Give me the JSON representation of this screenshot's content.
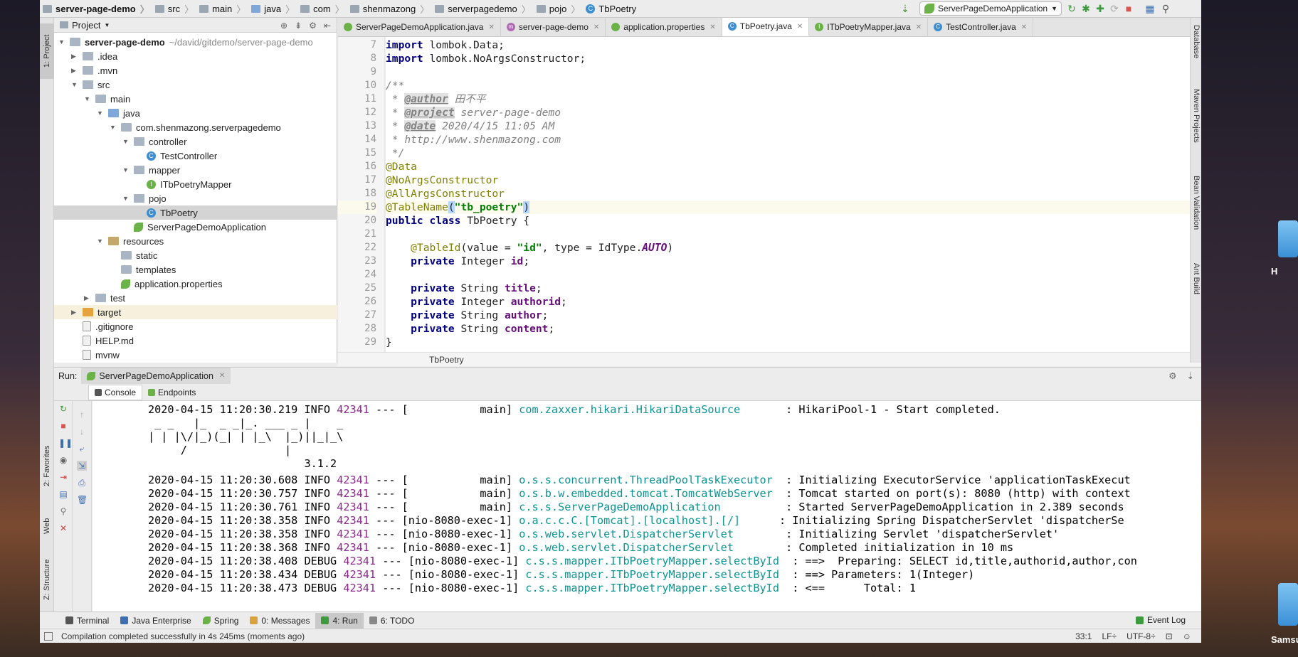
{
  "desktop": {
    "drive_label_top": "H",
    "drive_label_bottom": "Samsu"
  },
  "navbar": {
    "crumbs": [
      "server-page-demo",
      "src",
      "main",
      "java",
      "com",
      "shenmazong",
      "serverpagedemo",
      "pojo",
      "TbPoetry"
    ],
    "run_config": "ServerPageDemoApplication"
  },
  "left_stripe": {
    "project": "1: Project",
    "favorites": "2: Favorites",
    "web": "Web",
    "structure": "Z: Structure"
  },
  "project_panel": {
    "title": "Project",
    "tree": [
      {
        "label": "server-page-demo",
        "note": "~/david/gitdemo/server-page-demo"
      },
      {
        "label": ".idea"
      },
      {
        "label": ".mvn"
      },
      {
        "label": "src"
      },
      {
        "label": "main"
      },
      {
        "label": "java"
      },
      {
        "label": "com.shenmazong.serverpagedemo"
      },
      {
        "label": "controller"
      },
      {
        "label": "TestController"
      },
      {
        "label": "mapper"
      },
      {
        "label": "ITbPoetryMapper"
      },
      {
        "label": "pojo"
      },
      {
        "label": "TbPoetry"
      },
      {
        "label": "ServerPageDemoApplication"
      },
      {
        "label": "resources"
      },
      {
        "label": "static"
      },
      {
        "label": "templates"
      },
      {
        "label": "application.properties"
      },
      {
        "label": "test"
      },
      {
        "label": "target"
      },
      {
        "label": ".gitignore"
      },
      {
        "label": "HELP.md"
      },
      {
        "label": "mvnw"
      }
    ]
  },
  "editor": {
    "tabs": [
      "ServerPageDemoApplication.java",
      "server-page-demo",
      "application.properties",
      "TbPoetry.java",
      "ITbPoetryMapper.java",
      "TestController.java"
    ],
    "active_tab": "TbPoetry.java",
    "line_numbers": [
      "7",
      "8",
      "9",
      "10",
      "11",
      "12",
      "13",
      "14",
      "15",
      "16",
      "17",
      "18",
      "19",
      "20",
      "21",
      "22",
      "23",
      "24",
      "25",
      "26",
      "27",
      "28",
      "29"
    ],
    "lines": {
      "l7a": "import ",
      "l7b": "lombok.Data;",
      "l8a": "import ",
      "l8b": "lombok.NoArgsConstructor;",
      "l10": "/**",
      "l11a": " * ",
      "l11b": "@author",
      "l11c": " 田不平",
      "l12a": " * ",
      "l12b": "@project",
      "l12c": " server-page-demo",
      "l13a": " * ",
      "l13b": "@date",
      "l13c": " 2020/4/15 11:05 AM",
      "l14": " * http://www.shenmazong.com",
      "l15": " */",
      "l16": "@Data",
      "l17": "@NoArgsConstructor",
      "l18": "@AllArgsConstructor",
      "l19a": "@TableName",
      "l19b": "(",
      "l19c": "\"tb_poetry\"",
      "l19d": ")",
      "l20a": "public class ",
      "l20b": "TbPoetry {",
      "l22a": "    @TableId",
      "l22b": "(value = ",
      "l22c": "\"id\"",
      "l22d": ", type = IdType.",
      "l22e": "AUTO",
      "l22f": ")",
      "l23a": "    private ",
      "l23b": "Integer ",
      "l23c": "id",
      "l23d": ";",
      "l25a": "    private ",
      "l25b": "String ",
      "l25c": "title",
      "l25d": ";",
      "l26a": "    private ",
      "l26b": "Integer ",
      "l26c": "authorid",
      "l26d": ";",
      "l27a": "    private ",
      "l27b": "String ",
      "l27c": "author",
      "l27d": ";",
      "l28a": "    private ",
      "l28b": "String ",
      "l28c": "content",
      "l28d": ";",
      "l29": "}"
    },
    "breadcrumb": "TbPoetry"
  },
  "right_stripe": {
    "database": "Database",
    "maven": "Maven Projects",
    "bean": "Bean Validation",
    "ant": "Ant Build"
  },
  "run_panel": {
    "label": "Run:",
    "config": "ServerPageDemoApplication",
    "tabs": [
      "Console",
      "Endpoints"
    ],
    "console_lines": [
      {
        "ts": "2020-04-15 11:20:30.219",
        "lvl": " INFO ",
        "pid": "42341",
        "mid": " --- [           main] ",
        "logger": "com.zaxxer.hikari.HikariDataSource      ",
        "msg": " : HikariPool-1 - Start completed."
      },
      {
        "plain": " _ _   |_  _ _|_. ___ _ |    _"
      },
      {
        "plain": "| | |\\/|_)(_| | |_\\  |_)||_|_\\"
      },
      {
        "plain": "     /               |"
      },
      {
        "plain": "                        3.1.2"
      },
      {
        "ts": "2020-04-15 11:20:30.608",
        "lvl": " INFO ",
        "pid": "42341",
        "mid": " --- [           main] ",
        "logger": "o.s.s.concurrent.ThreadPoolTaskExecutor ",
        "msg": " : Initializing ExecutorService 'applicationTaskExecut"
      },
      {
        "ts": "2020-04-15 11:20:30.757",
        "lvl": " INFO ",
        "pid": "42341",
        "mid": " --- [           main] ",
        "logger": "o.s.b.w.embedded.tomcat.TomcatWebServer ",
        "msg": " : Tomcat started on port(s): 8080 (http) with context"
      },
      {
        "ts": "2020-04-15 11:20:30.761",
        "lvl": " INFO ",
        "pid": "42341",
        "mid": " --- [           main] ",
        "logger": "c.s.s.ServerPageDemoApplication         ",
        "msg": " : Started ServerPageDemoApplication in 2.389 seconds"
      },
      {
        "ts": "2020-04-15 11:20:38.358",
        "lvl": " INFO ",
        "pid": "42341",
        "mid": " --- [nio-8080-exec-1] ",
        "logger": "o.a.c.c.C.[Tomcat].[localhost].[/]     ",
        "msg": " : Initializing Spring DispatcherServlet 'dispatcherSe"
      },
      {
        "ts": "2020-04-15 11:20:38.358",
        "lvl": " INFO ",
        "pid": "42341",
        "mid": " --- [nio-8080-exec-1] ",
        "logger": "o.s.web.servlet.DispatcherServlet       ",
        "msg": " : Initializing Servlet 'dispatcherServlet'"
      },
      {
        "ts": "2020-04-15 11:20:38.368",
        "lvl": " INFO ",
        "pid": "42341",
        "mid": " --- [nio-8080-exec-1] ",
        "logger": "o.s.web.servlet.DispatcherServlet       ",
        "msg": " : Completed initialization in 10 ms"
      },
      {
        "ts": "2020-04-15 11:20:38.408",
        "lvl": " DEBUG ",
        "pid": "42341",
        "mid": " --- [nio-8080-exec-1] ",
        "logger": "c.s.s.mapper.ITbPoetryMapper.selectById ",
        "msg": " : ==>  Preparing: SELECT id,title,authorid,author,con"
      },
      {
        "ts": "2020-04-15 11:20:38.434",
        "lvl": " DEBUG ",
        "pid": "42341",
        "mid": " --- [nio-8080-exec-1] ",
        "logger": "c.s.s.mapper.ITbPoetryMapper.selectById ",
        "msg": " : ==> Parameters: 1(Integer)"
      },
      {
        "ts": "2020-04-15 11:20:38.473",
        "lvl": " DEBUG ",
        "pid": "42341",
        "mid": " --- [nio-8080-exec-1] ",
        "logger": "c.s.s.mapper.ITbPoetryMapper.selectById ",
        "msg": " : <==      Total: 1"
      }
    ]
  },
  "bottom_tools": [
    "Terminal",
    "Java Enterprise",
    "Spring",
    "0: Messages",
    "4: Run",
    "6: TODO"
  ],
  "event_log": "Event Log",
  "status": {
    "message": "Compilation completed successfully in 4s 245ms (moments ago)",
    "position": "33:1",
    "line_sep": "LF÷",
    "encoding": "UTF-8÷"
  },
  "colors": {
    "accent_blue": "#3d8ed1",
    "spring_green": "#6bb249",
    "log_logger": "#0a9494",
    "log_pid": "#8a2a8a"
  }
}
